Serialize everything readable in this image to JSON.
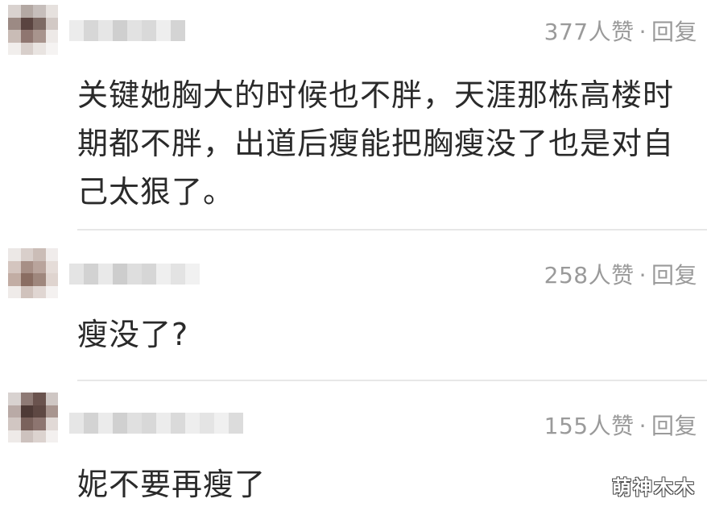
{
  "comments": [
    {
      "likes": "377人赞",
      "separator": "·",
      "reply": "回复",
      "text": "关键她胸大的时候也不胖，天涯那栋高楼时期都不胖，出道后瘦能把胸瘦没了也是对自己太狠了。"
    },
    {
      "likes": "258人赞",
      "separator": "·",
      "reply": "回复",
      "text": "瘦没了?"
    },
    {
      "likes": "155人赞",
      "separator": "·",
      "reply": "回复",
      "text": "妮不要再瘦了"
    }
  ],
  "watermark": "萌神木木",
  "colors": {
    "meta_text": "#9a9a9a",
    "body_text": "#2a2a2a",
    "divider": "#e7e7e7"
  }
}
